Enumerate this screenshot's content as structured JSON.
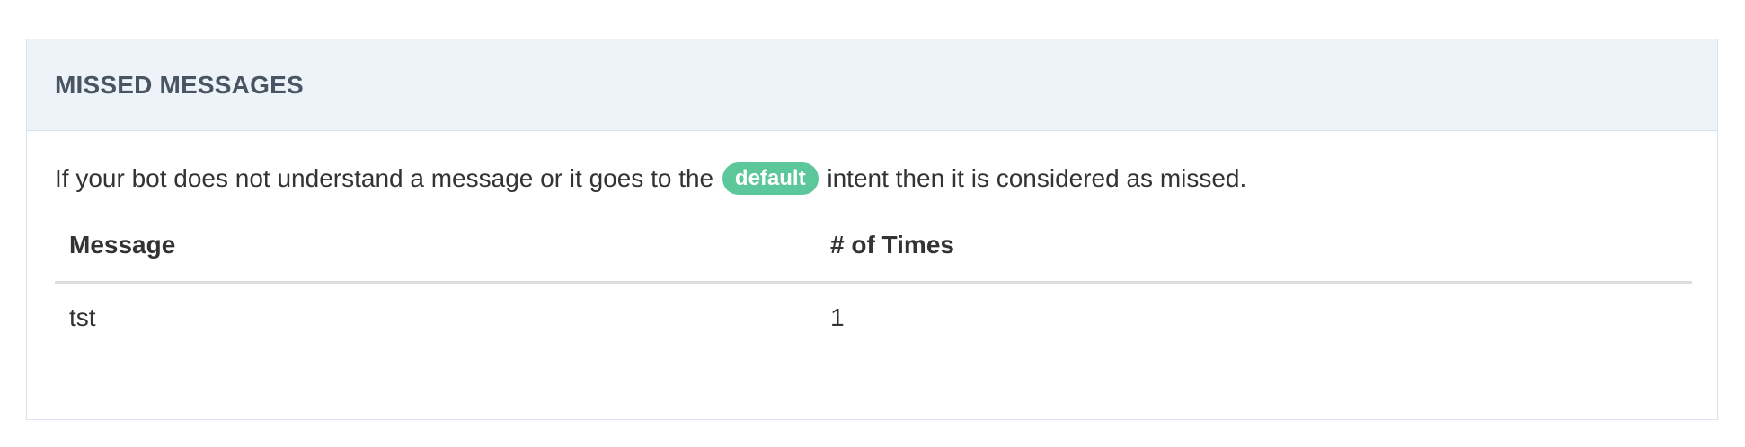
{
  "panel": {
    "title": "MISSED MESSAGES",
    "description": {
      "before": "If your bot does not understand a message or it goes to the",
      "badge": "default",
      "after": "intent then it is considered as missed."
    }
  },
  "table": {
    "headers": {
      "message": "Message",
      "times": "# of Times"
    },
    "rows": [
      {
        "message": "tst",
        "times": "1"
      }
    ]
  },
  "colors": {
    "heading_bg": "#eef3fa",
    "border": "#d9e3ef",
    "badge": "#5bc79b",
    "title_text": "#4a5563"
  }
}
